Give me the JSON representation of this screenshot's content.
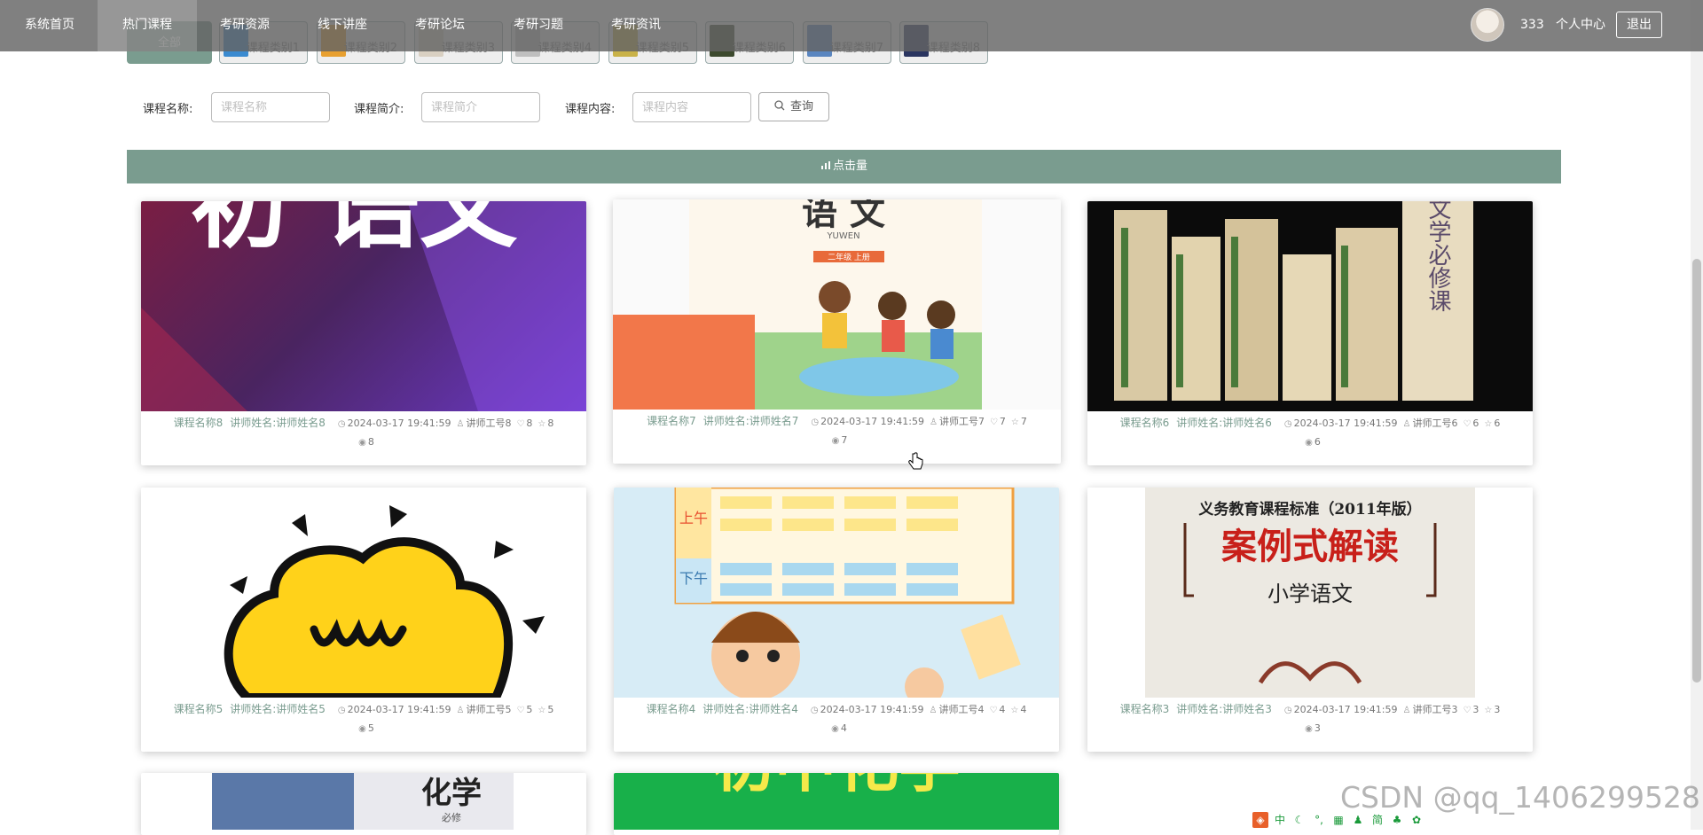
{
  "nav": {
    "items": [
      "系统首页",
      "热门课程",
      "考研资源",
      "线下讲座",
      "考研论坛",
      "考研习题",
      "考研资讯"
    ],
    "username": "333",
    "user_center": "个人中心",
    "logout": "退出"
  },
  "categories": [
    "全部",
    "课程类别1",
    "课程类别2",
    "课程类别3",
    "课程类别4",
    "课程类别5",
    "课程类别6",
    "课程类别7",
    "课程类别8"
  ],
  "search": {
    "name_label": "课程名称:",
    "name_placeholder": "课程名称",
    "intro_label": "课程简介:",
    "intro_placeholder": "课程简介",
    "content_label": "课程内容:",
    "content_placeholder": "课程内容",
    "button": "查询"
  },
  "sort_label": "点击量",
  "courses": [
    {
      "name": "课程名称8",
      "teacher": "讲师姓名:讲师姓名8",
      "time": "2024-03-17 19:41:59",
      "teacher_id": "讲师工号8",
      "likes": "8",
      "stars": "8",
      "views": "8",
      "art": "初 语文"
    },
    {
      "name": "课程名称7",
      "teacher": "讲师姓名:讲师姓名7",
      "time": "2024-03-17 19:41:59",
      "teacher_id": "讲师工号7",
      "likes": "7",
      "stars": "7",
      "views": "7",
      "art": "语 文",
      "art_sub": "YUWEN",
      "art_grade": "二年级 上册"
    },
    {
      "name": "课程名称6",
      "teacher": "讲师姓名:讲师姓名6",
      "time": "2024-03-17 19:41:59",
      "teacher_id": "讲师工号6",
      "likes": "6",
      "stars": "6",
      "views": "6",
      "art": "文学必修课"
    },
    {
      "name": "课程名称5",
      "teacher": "讲师姓名:讲师姓名5",
      "time": "2024-03-17 19:41:59",
      "teacher_id": "讲师工号5",
      "likes": "5",
      "stars": "5",
      "views": "5"
    },
    {
      "name": "课程名称4",
      "teacher": "讲师姓名:讲师姓名4",
      "time": "2024-03-17 19:41:59",
      "teacher_id": "讲师工号4",
      "likes": "4",
      "stars": "4",
      "views": "4",
      "art_up": "上午",
      "art_down": "下午"
    },
    {
      "name": "课程名称3",
      "teacher": "讲师姓名:讲师姓名3",
      "time": "2024-03-17 19:41:59",
      "teacher_id": "讲师工号3",
      "likes": "3",
      "stars": "3",
      "views": "3",
      "art_title": "义务教育课程标准（2011年版）",
      "art_big": "案例式解读",
      "art_sub": "小学语文"
    }
  ],
  "partial_cards": [
    {
      "art": "化学",
      "art_sub": "必修"
    },
    {
      "art": "初中化学"
    }
  ],
  "watermark": "CSDN @qq_1406299528",
  "ime": [
    "中",
    "简"
  ],
  "colors": {
    "accent": "#7a9c8f",
    "nav_bg": "#646464"
  }
}
